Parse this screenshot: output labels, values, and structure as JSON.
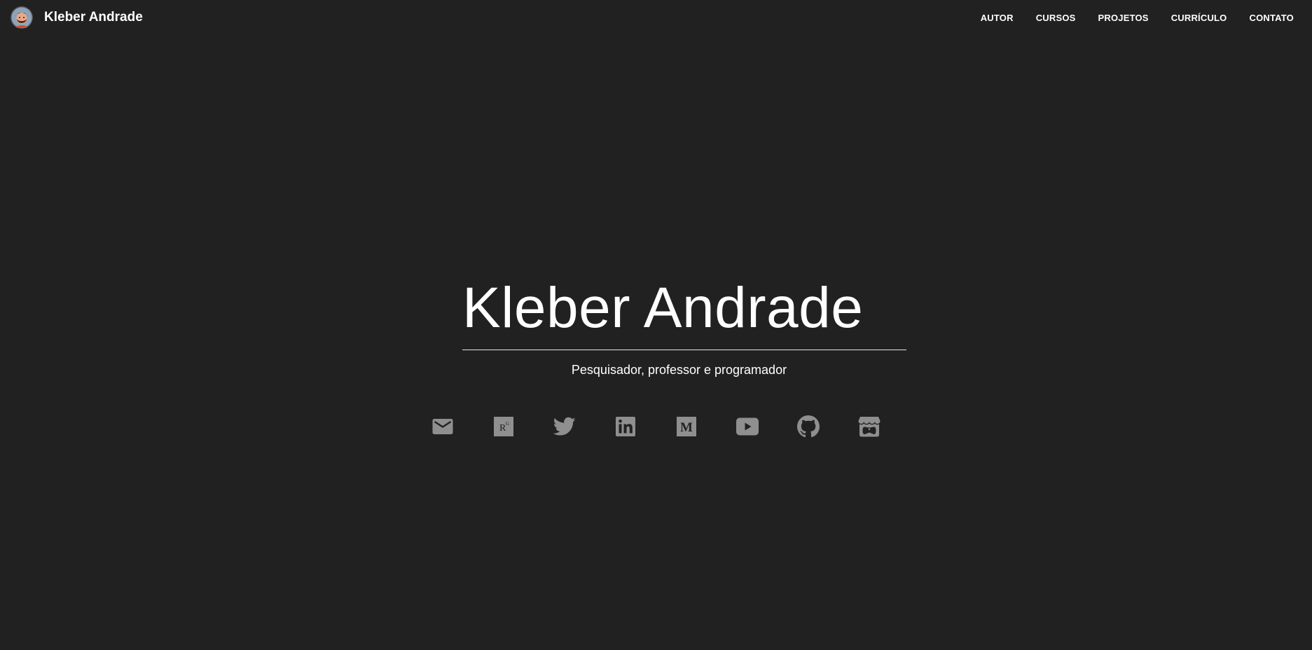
{
  "navbar": {
    "brand_name": "Kleber Andrade",
    "avatar_icon": "avatar-cartoon-portrait",
    "links": [
      {
        "label": "AUTOR"
      },
      {
        "label": "CURSOS"
      },
      {
        "label": "PROJETOS"
      },
      {
        "label": "CURRÍCULO"
      },
      {
        "label": "CONTATO"
      }
    ]
  },
  "hero": {
    "title": "Kleber Andrade",
    "subtitle": "Pesquisador, professor e programador",
    "social_icons": [
      {
        "icon": "email-icon"
      },
      {
        "icon": "researchgate-icon"
      },
      {
        "icon": "twitter-icon"
      },
      {
        "icon": "linkedin-icon"
      },
      {
        "icon": "medium-icon"
      },
      {
        "icon": "youtube-icon"
      },
      {
        "icon": "github-icon"
      },
      {
        "icon": "itchio-icon"
      }
    ]
  },
  "colors": {
    "background": "#212121",
    "text": "#ffffff",
    "icon": "#8f8f8f",
    "rule": "#e6e6e6"
  }
}
